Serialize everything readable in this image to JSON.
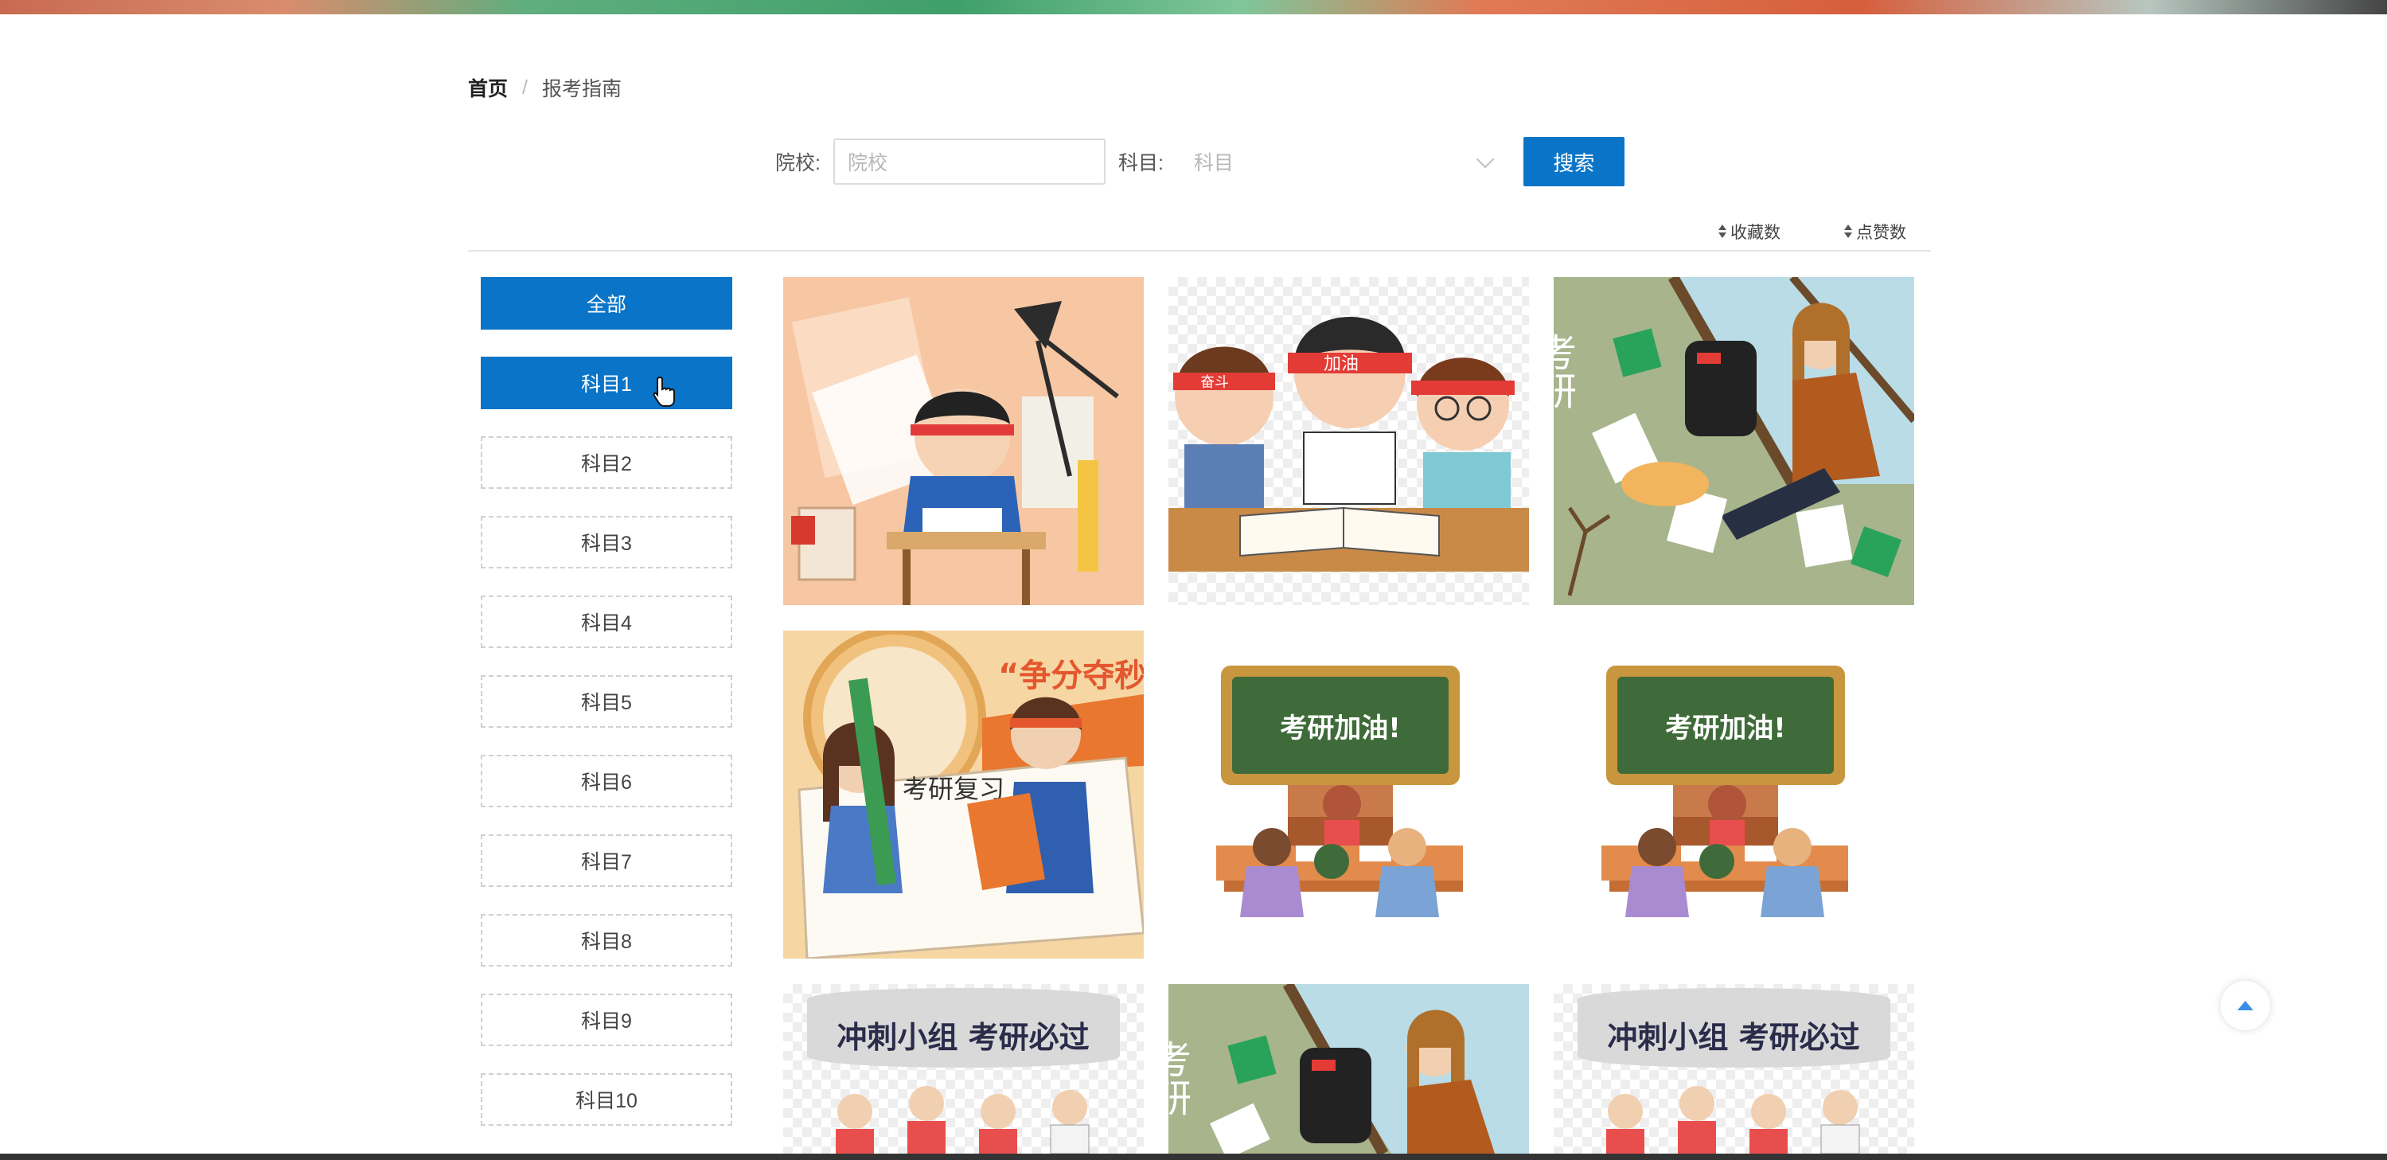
{
  "breadcrumb": {
    "home": "首页",
    "separator": "/",
    "current": "报考指南"
  },
  "search": {
    "school_label": "院校:",
    "school_placeholder": "院校",
    "subject_label": "科目:",
    "subject_placeholder": "科目",
    "button_label": "搜索"
  },
  "sort": {
    "favorites": "收藏数",
    "likes": "点赞数"
  },
  "sidebar": {
    "items": [
      {
        "label": "全部",
        "active": true
      },
      {
        "label": "科目1",
        "active": true
      },
      {
        "label": "科目2",
        "active": false
      },
      {
        "label": "科目3",
        "active": false
      },
      {
        "label": "科目4",
        "active": false
      },
      {
        "label": "科目5",
        "active": false
      },
      {
        "label": "科目6",
        "active": false
      },
      {
        "label": "科目7",
        "active": false
      },
      {
        "label": "科目8",
        "active": false
      },
      {
        "label": "科目9",
        "active": false
      },
      {
        "label": "科目10",
        "active": false
      }
    ]
  },
  "grid": {
    "images": [
      {
        "icon": "student-studying-illustration"
      },
      {
        "icon": "three-students-jiayou-illustration",
        "headband_text": "加油",
        "side_text": "奋斗"
      },
      {
        "icon": "girl-reading-window-illustration",
        "side_text": "考研"
      },
      {
        "icon": "two-students-exam-illustration",
        "banner_text": "“争分夺秒",
        "paper_text": "考研复习"
      },
      {
        "icon": "classroom-blackboard-illustration",
        "board_text": "考研加油!"
      },
      {
        "icon": "classroom-blackboard-illustration",
        "board_text": "考研加油!"
      },
      {
        "icon": "group-bubble-illustration",
        "bubble_text": "冲刺小组  考研必过"
      },
      {
        "icon": "girl-reading-window-illustration",
        "side_text": "考研"
      },
      {
        "icon": "group-bubble-illustration",
        "bubble_text": "冲刺小组  考研必过"
      }
    ]
  },
  "colors": {
    "primary": "#0a75c8",
    "border": "#d0d0d0",
    "board_green": "#3f6b3a",
    "board_frame": "#c8963e"
  }
}
